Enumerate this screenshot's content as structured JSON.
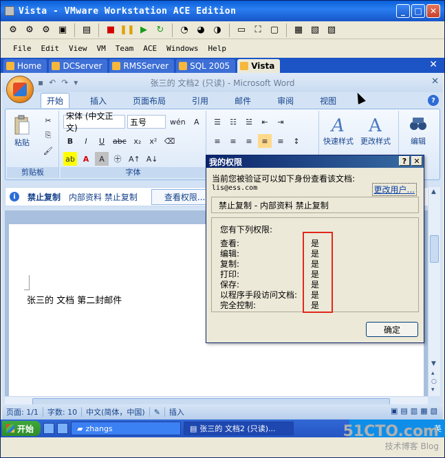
{
  "vm": {
    "title": "Vista - VMware Workstation ACE Edition",
    "menu": [
      "File",
      "Edit",
      "View",
      "VM",
      "Team",
      "ACE",
      "Windows",
      "Help"
    ],
    "tabs": [
      "Home",
      "DCServer",
      "RMSServer",
      "SQL 2005",
      "Vista"
    ],
    "active_tab": "Vista"
  },
  "word": {
    "title": "张三的 文档2 (只读) - Microsoft Word",
    "ribbon_tabs": [
      "开始",
      "插入",
      "页面布局",
      "引用",
      "邮件",
      "审阅",
      "视图"
    ],
    "clipboard": {
      "paste": "粘贴",
      "label": "剪贴板"
    },
    "font": {
      "name": "宋体 (中文正文)",
      "size": "五号",
      "label": "字体"
    },
    "styles": {
      "quick": "快速样式",
      "change": "更改样式"
    },
    "editing": {
      "label": "编辑"
    },
    "permission_bar": {
      "title": "禁止复制",
      "policy": "内部资料 禁止复制",
      "button": "查看权限..."
    },
    "doc_text": "张三的 文档 第二封邮件",
    "status": {
      "page": "页面: 1/1",
      "words": "字数: 10",
      "lang": "中文(简体，中国)",
      "mode": "插入"
    }
  },
  "dialog": {
    "title": "我的权限",
    "line1": "当前您被验证可以如下身份查看该文档:",
    "email": "lis@ess.com",
    "change_user": "更改用户...",
    "policy": "禁止复制 - 内部资料 禁止复制",
    "perms_head": "您有下列权限:",
    "perms": [
      {
        "name": "查看:",
        "value": "是"
      },
      {
        "name": "编辑:",
        "value": "是"
      },
      {
        "name": "复制:",
        "value": "是"
      },
      {
        "name": "打印:",
        "value": "是"
      },
      {
        "name": "保存:",
        "value": "是"
      },
      {
        "name": "以程序手段访问文档:",
        "value": "是"
      },
      {
        "name": "完全控制:",
        "value": "是"
      }
    ],
    "ok": "确定"
  },
  "taskbar": {
    "start": "开始",
    "items": [
      "zhangs",
      "张三的 文档2 (只读)..."
    ],
    "tray_text": "英"
  },
  "watermark": {
    "line1": "51CTO.com",
    "line2": "技术博客 Blog"
  }
}
